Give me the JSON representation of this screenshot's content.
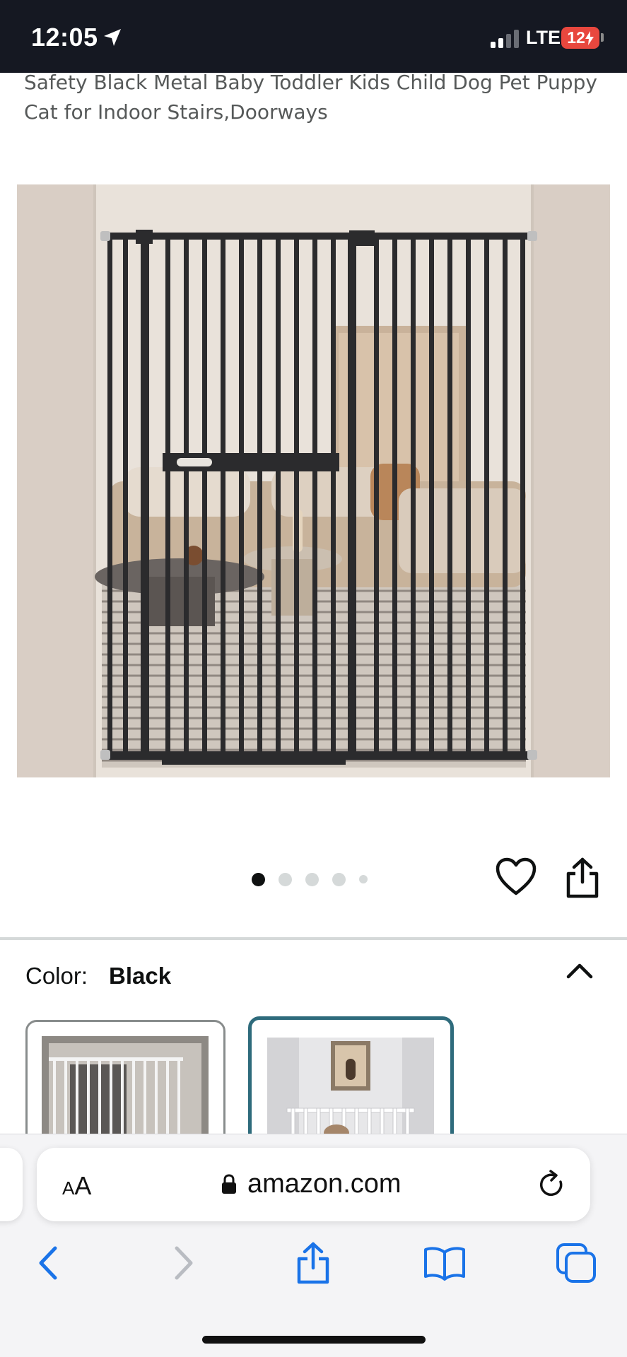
{
  "status_bar": {
    "time": "12:05",
    "network": "LTE",
    "battery": "12",
    "icons": [
      "location-arrow-icon",
      "signal-bars-icon",
      "charging-bolt-icon"
    ]
  },
  "product": {
    "title": "Safety Black Metal Baby Toddler Kids Child Dog Pet Puppy Cat for Indoor Stairs,Doorways",
    "image_description_icon": "baby-gate-photo",
    "carousel": {
      "total_dots": 5,
      "active_index": 0
    }
  },
  "actions": {
    "icons": [
      "heart-icon",
      "share-icon"
    ]
  },
  "variation": {
    "label": "Color:",
    "value": "Black",
    "options": [
      "white-gate-swatch",
      "black-gate-swatch"
    ],
    "selected_index": 1,
    "selected_border_color": "#2e6b7c"
  },
  "browser": {
    "aa_label_large": "A",
    "aa_label_small": "A",
    "url": "amazon.com",
    "icons": [
      "lock-icon",
      "reload-icon",
      "back-icon",
      "forward-icon",
      "share-icon",
      "bookmarks-icon",
      "tabs-icon"
    ]
  },
  "colors": {
    "status_bar_bg": "#151822",
    "battery": "#e8473e",
    "link_blue": "#1a73e8",
    "title_gray": "#565959"
  }
}
